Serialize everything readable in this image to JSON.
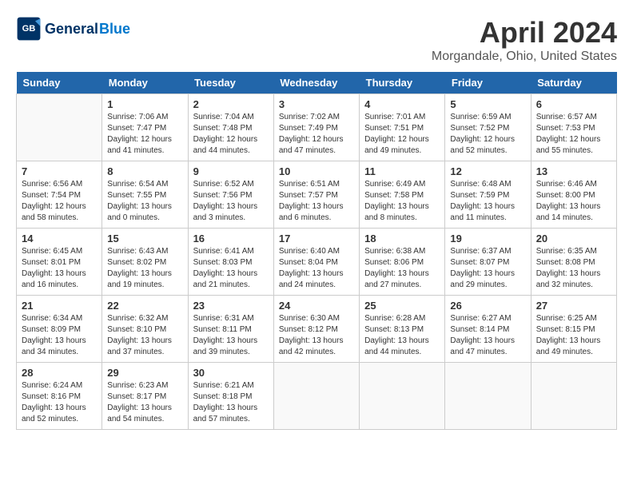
{
  "header": {
    "logo_line1": "General",
    "logo_line2": "Blue",
    "month_title": "April 2024",
    "location": "Morgandale, Ohio, United States"
  },
  "weekdays": [
    "Sunday",
    "Monday",
    "Tuesday",
    "Wednesday",
    "Thursday",
    "Friday",
    "Saturday"
  ],
  "weeks": [
    [
      {
        "day": "",
        "sunrise": "",
        "sunset": "",
        "daylight": ""
      },
      {
        "day": "1",
        "sunrise": "Sunrise: 7:06 AM",
        "sunset": "Sunset: 7:47 PM",
        "daylight": "Daylight: 12 hours and 41 minutes."
      },
      {
        "day": "2",
        "sunrise": "Sunrise: 7:04 AM",
        "sunset": "Sunset: 7:48 PM",
        "daylight": "Daylight: 12 hours and 44 minutes."
      },
      {
        "day": "3",
        "sunrise": "Sunrise: 7:02 AM",
        "sunset": "Sunset: 7:49 PM",
        "daylight": "Daylight: 12 hours and 47 minutes."
      },
      {
        "day": "4",
        "sunrise": "Sunrise: 7:01 AM",
        "sunset": "Sunset: 7:51 PM",
        "daylight": "Daylight: 12 hours and 49 minutes."
      },
      {
        "day": "5",
        "sunrise": "Sunrise: 6:59 AM",
        "sunset": "Sunset: 7:52 PM",
        "daylight": "Daylight: 12 hours and 52 minutes."
      },
      {
        "day": "6",
        "sunrise": "Sunrise: 6:57 AM",
        "sunset": "Sunset: 7:53 PM",
        "daylight": "Daylight: 12 hours and 55 minutes."
      }
    ],
    [
      {
        "day": "7",
        "sunrise": "Sunrise: 6:56 AM",
        "sunset": "Sunset: 7:54 PM",
        "daylight": "Daylight: 12 hours and 58 minutes."
      },
      {
        "day": "8",
        "sunrise": "Sunrise: 6:54 AM",
        "sunset": "Sunset: 7:55 PM",
        "daylight": "Daylight: 13 hours and 0 minutes."
      },
      {
        "day": "9",
        "sunrise": "Sunrise: 6:52 AM",
        "sunset": "Sunset: 7:56 PM",
        "daylight": "Daylight: 13 hours and 3 minutes."
      },
      {
        "day": "10",
        "sunrise": "Sunrise: 6:51 AM",
        "sunset": "Sunset: 7:57 PM",
        "daylight": "Daylight: 13 hours and 6 minutes."
      },
      {
        "day": "11",
        "sunrise": "Sunrise: 6:49 AM",
        "sunset": "Sunset: 7:58 PM",
        "daylight": "Daylight: 13 hours and 8 minutes."
      },
      {
        "day": "12",
        "sunrise": "Sunrise: 6:48 AM",
        "sunset": "Sunset: 7:59 PM",
        "daylight": "Daylight: 13 hours and 11 minutes."
      },
      {
        "day": "13",
        "sunrise": "Sunrise: 6:46 AM",
        "sunset": "Sunset: 8:00 PM",
        "daylight": "Daylight: 13 hours and 14 minutes."
      }
    ],
    [
      {
        "day": "14",
        "sunrise": "Sunrise: 6:45 AM",
        "sunset": "Sunset: 8:01 PM",
        "daylight": "Daylight: 13 hours and 16 minutes."
      },
      {
        "day": "15",
        "sunrise": "Sunrise: 6:43 AM",
        "sunset": "Sunset: 8:02 PM",
        "daylight": "Daylight: 13 hours and 19 minutes."
      },
      {
        "day": "16",
        "sunrise": "Sunrise: 6:41 AM",
        "sunset": "Sunset: 8:03 PM",
        "daylight": "Daylight: 13 hours and 21 minutes."
      },
      {
        "day": "17",
        "sunrise": "Sunrise: 6:40 AM",
        "sunset": "Sunset: 8:04 PM",
        "daylight": "Daylight: 13 hours and 24 minutes."
      },
      {
        "day": "18",
        "sunrise": "Sunrise: 6:38 AM",
        "sunset": "Sunset: 8:06 PM",
        "daylight": "Daylight: 13 hours and 27 minutes."
      },
      {
        "day": "19",
        "sunrise": "Sunrise: 6:37 AM",
        "sunset": "Sunset: 8:07 PM",
        "daylight": "Daylight: 13 hours and 29 minutes."
      },
      {
        "day": "20",
        "sunrise": "Sunrise: 6:35 AM",
        "sunset": "Sunset: 8:08 PM",
        "daylight": "Daylight: 13 hours and 32 minutes."
      }
    ],
    [
      {
        "day": "21",
        "sunrise": "Sunrise: 6:34 AM",
        "sunset": "Sunset: 8:09 PM",
        "daylight": "Daylight: 13 hours and 34 minutes."
      },
      {
        "day": "22",
        "sunrise": "Sunrise: 6:32 AM",
        "sunset": "Sunset: 8:10 PM",
        "daylight": "Daylight: 13 hours and 37 minutes."
      },
      {
        "day": "23",
        "sunrise": "Sunrise: 6:31 AM",
        "sunset": "Sunset: 8:11 PM",
        "daylight": "Daylight: 13 hours and 39 minutes."
      },
      {
        "day": "24",
        "sunrise": "Sunrise: 6:30 AM",
        "sunset": "Sunset: 8:12 PM",
        "daylight": "Daylight: 13 hours and 42 minutes."
      },
      {
        "day": "25",
        "sunrise": "Sunrise: 6:28 AM",
        "sunset": "Sunset: 8:13 PM",
        "daylight": "Daylight: 13 hours and 44 minutes."
      },
      {
        "day": "26",
        "sunrise": "Sunrise: 6:27 AM",
        "sunset": "Sunset: 8:14 PM",
        "daylight": "Daylight: 13 hours and 47 minutes."
      },
      {
        "day": "27",
        "sunrise": "Sunrise: 6:25 AM",
        "sunset": "Sunset: 8:15 PM",
        "daylight": "Daylight: 13 hours and 49 minutes."
      }
    ],
    [
      {
        "day": "28",
        "sunrise": "Sunrise: 6:24 AM",
        "sunset": "Sunset: 8:16 PM",
        "daylight": "Daylight: 13 hours and 52 minutes."
      },
      {
        "day": "29",
        "sunrise": "Sunrise: 6:23 AM",
        "sunset": "Sunset: 8:17 PM",
        "daylight": "Daylight: 13 hours and 54 minutes."
      },
      {
        "day": "30",
        "sunrise": "Sunrise: 6:21 AM",
        "sunset": "Sunset: 8:18 PM",
        "daylight": "Daylight: 13 hours and 57 minutes."
      },
      {
        "day": "",
        "sunrise": "",
        "sunset": "",
        "daylight": ""
      },
      {
        "day": "",
        "sunrise": "",
        "sunset": "",
        "daylight": ""
      },
      {
        "day": "",
        "sunrise": "",
        "sunset": "",
        "daylight": ""
      },
      {
        "day": "",
        "sunrise": "",
        "sunset": "",
        "daylight": ""
      }
    ]
  ]
}
